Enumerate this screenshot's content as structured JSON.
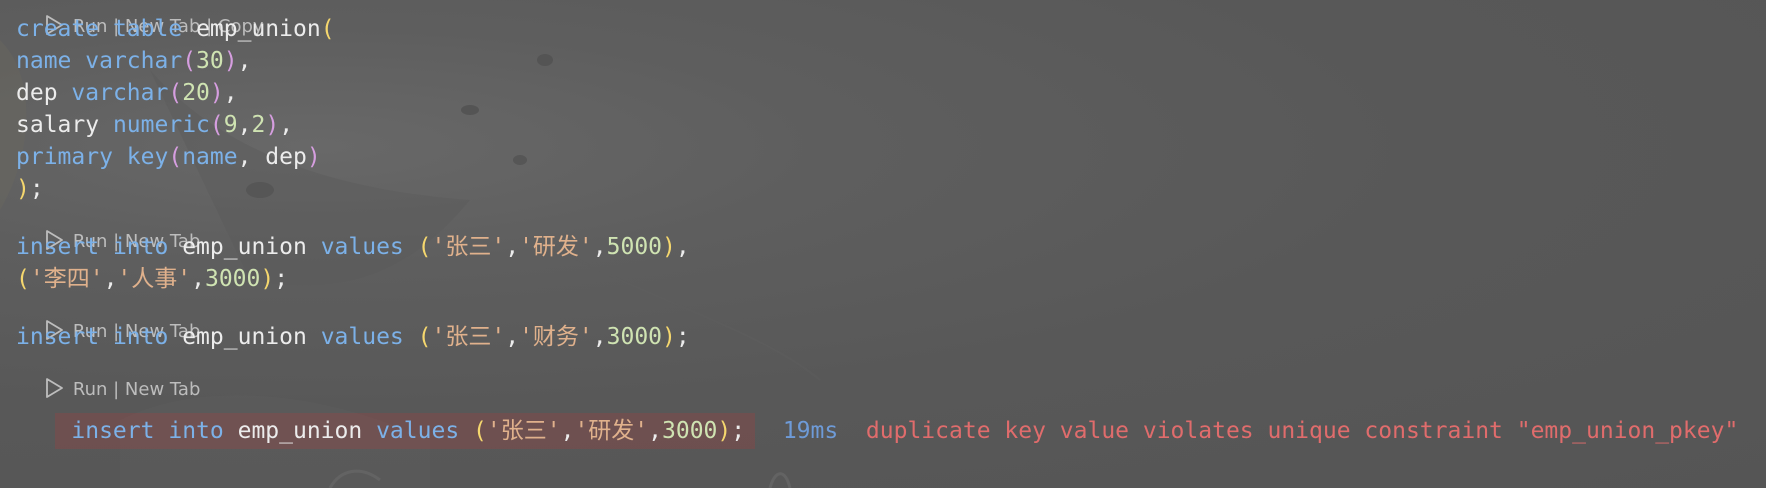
{
  "codelens": {
    "top_partial": "Run | New Tab | Copy",
    "run": "Run",
    "sep": " | ",
    "new_tab": "New Tab"
  },
  "code": {
    "l1": {
      "kw1": "create",
      "kw2": "table",
      "name": "emp_union",
      "paren": "("
    },
    "l2": {
      "kw": "name",
      "type": "varchar",
      "po": "(",
      "num": "30",
      "pc": ")",
      "comma": ","
    },
    "l3": {
      "id": "dep",
      "type": "varchar",
      "po": "(",
      "num": "20",
      "pc": ")",
      "comma": ","
    },
    "l4": {
      "id": "salary",
      "type": "numeric",
      "po": "(",
      "n1": "9",
      "c": ",",
      "n2": "2",
      "pc": ")",
      "comma": ","
    },
    "l5": {
      "kw1": "primary",
      "kw2": "key",
      "po": "(",
      "a": "name",
      "c": ", ",
      "b": "dep",
      "pc": ")"
    },
    "l6": {
      "pc": ")",
      "semi": ";"
    },
    "l7": {
      "kw1": "insert",
      "kw2": "into",
      "name": "emp_union",
      "kw3": "values",
      "po": "(",
      "s1": "'张三'",
      "c1": ",",
      "s2": "'研发'",
      "c2": ",",
      "num": "5000",
      "pc": ")",
      "end": ","
    },
    "l8": {
      "po": "(",
      "s1": "'李四'",
      "c1": ",",
      "s2": "'人事'",
      "c2": ",",
      "num": "3000",
      "pc": ")",
      "end": ";"
    },
    "l9": {
      "kw1": "insert",
      "kw2": "into",
      "name": "emp_union",
      "kw3": "values",
      "po": "(",
      "s1": "'张三'",
      "c1": ",",
      "s2": "'财务'",
      "c2": ",",
      "num": "3000",
      "pc": ")",
      "end": ";"
    },
    "l10": {
      "kw1": "insert",
      "kw2": "into",
      "name": "emp_union",
      "kw3": "values",
      "po": "(",
      "s1": "'张三'",
      "c1": ",",
      "s2": "'研发'",
      "c2": ",",
      "num": "3000",
      "pc": ")",
      "end": ";"
    }
  },
  "result": {
    "timing": "19ms",
    "error": "duplicate key value violates unique constraint \"emp_union_pkey\""
  },
  "colors": {
    "keyword": "#7cb1e8",
    "number": "#cfe3b2",
    "string": "#e0b18c",
    "paren_outer": "#f5d76e",
    "paren_inner": "#d69ee0",
    "error": "#e06c6c",
    "timing": "#6e9bd8",
    "error_highlight": "#6e4444"
  }
}
